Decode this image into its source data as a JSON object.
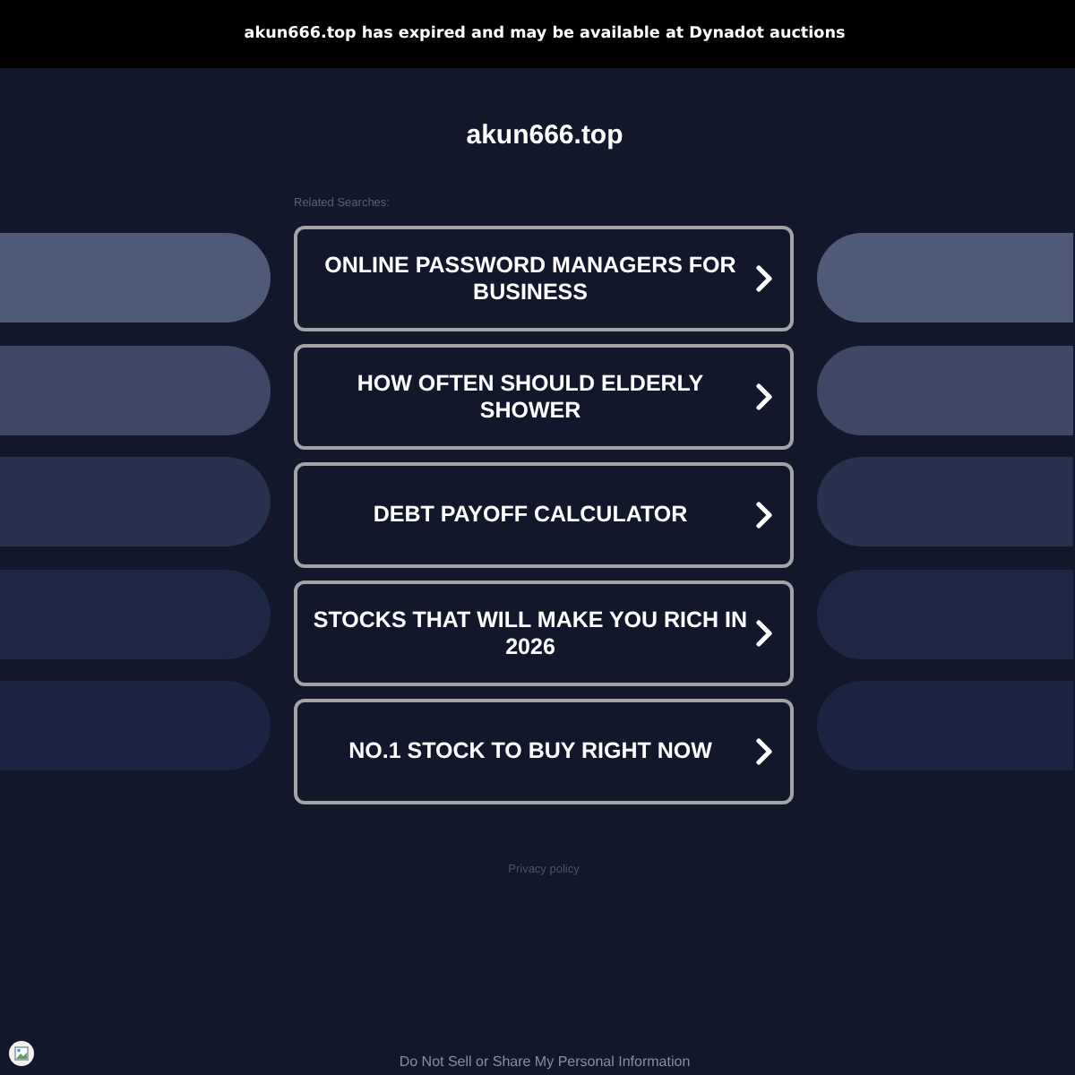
{
  "banner": {
    "text": "akun666.top has expired and may be available at Dynadot auctions"
  },
  "title": "akun666.top",
  "related_searches": {
    "label": "Related Searches:",
    "items": [
      {
        "text": "ONLINE PASSWORD MANAGERS FOR BUSINESS"
      },
      {
        "text": "HOW OFTEN SHOULD ELDERLY SHOWER"
      },
      {
        "text": "DEBT PAYOFF CALCULATOR"
      },
      {
        "text": "STOCKS THAT WILL MAKE YOU RICH IN 2026"
      },
      {
        "text": "NO.1 STOCK TO BUY RIGHT NOW"
      }
    ]
  },
  "privacy_link": "Privacy policy",
  "footer_link": "Do Not Sell or Share My Personal Information"
}
